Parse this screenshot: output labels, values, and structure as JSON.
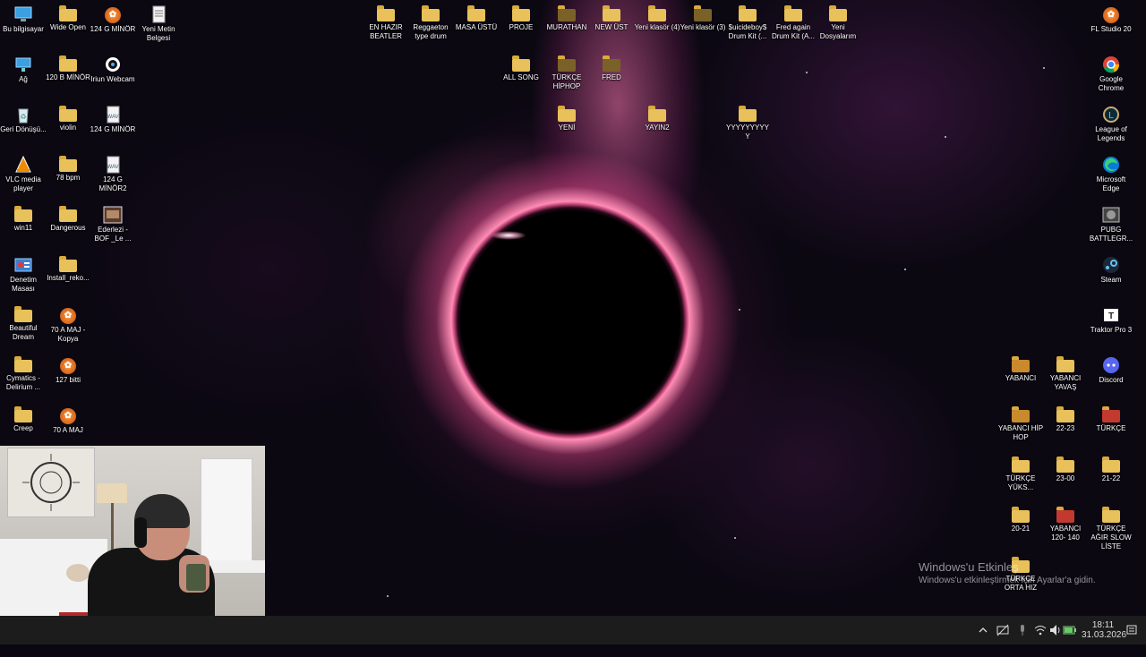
{
  "desktop": {
    "left_icons": [
      {
        "label": "Bu bilgisayar",
        "icon": "monitor-icon"
      },
      {
        "label": "Wide Open",
        "icon": "folder-icon"
      },
      {
        "label": "124 G MİNÖR",
        "icon": "fl-studio-project-icon"
      },
      {
        "label": "Yeni Metin Belgesi",
        "icon": "text-document-icon"
      },
      {
        "label": "Ağ",
        "icon": "network-icon"
      },
      {
        "label": "120 B MİNÖR",
        "icon": "folder-icon"
      },
      {
        "label": "Iriun Webcam",
        "icon": "webcam-icon"
      },
      {
        "label": "Geri Dönüşü...",
        "icon": "recycle-bin-icon"
      },
      {
        "label": "violin",
        "icon": "folder-icon"
      },
      {
        "label": "124 G MİNÖR",
        "icon": "audio-file-icon"
      },
      {
        "label": "VLC media player",
        "icon": "vlc-icon"
      },
      {
        "label": "78 bpm",
        "icon": "folder-icon"
      },
      {
        "label": "124 G MİNÖR2",
        "icon": "audio-file-icon"
      },
      {
        "label": "win11",
        "icon": "folder-icon"
      },
      {
        "label": "Dangerous",
        "icon": "folder-icon"
      },
      {
        "label": "Ederlezi - BOF _Le ...",
        "icon": "image-file-icon"
      },
      {
        "label": "Denetim Masası",
        "icon": "control-panel-icon"
      },
      {
        "label": "Install_reko...",
        "icon": "folder-icon"
      },
      {
        "label": "Beautiful Dream",
        "icon": "folder-icon"
      },
      {
        "label": "70 A MAJ - Kopya",
        "icon": "fl-studio-project-icon"
      },
      {
        "label": "Cymatics - Delirium ...",
        "icon": "folder-icon"
      },
      {
        "label": "127 bitti",
        "icon": "fl-studio-project-icon"
      },
      {
        "label": "Creep",
        "icon": "folder-icon"
      },
      {
        "label": "70 A MAJ",
        "icon": "fl-studio-project-icon"
      }
    ],
    "top_icons": [
      {
        "label": "EN HAZIR BEATLER",
        "icon": "folder-icon"
      },
      {
        "label": "Reggaeton type drum",
        "icon": "folder-icon"
      },
      {
        "label": "MASA ÜSTÜ",
        "icon": "folder-icon"
      },
      {
        "label": "PROJE",
        "icon": "folder-icon"
      },
      {
        "label": "MURATHAN",
        "icon": "folder-icon"
      },
      {
        "label": "NEW ÜST",
        "icon": "folder-icon"
      },
      {
        "label": "Yeni klasör (4)",
        "icon": "folder-icon"
      },
      {
        "label": "Yeni klasör (3)",
        "icon": "folder-icon"
      },
      {
        "label": "$uicideboy$ Drum Kit (...",
        "icon": "folder-icon"
      },
      {
        "label": "Fred again Drum Kit (A...",
        "icon": "folder-icon"
      },
      {
        "label": "Yeni Dosyalarım",
        "icon": "folder-icon"
      },
      {
        "label": "ALL SONG",
        "icon": "folder-icon"
      },
      {
        "label": "TÜRKÇE HİPHOP",
        "icon": "folder-icon"
      },
      {
        "label": "FRED",
        "icon": "folder-icon"
      },
      {
        "label": "YENİ",
        "icon": "folder-icon"
      },
      {
        "label": "YAYIN2",
        "icon": "folder-icon"
      },
      {
        "label": "YYYYYYYYYY",
        "icon": "folder-icon"
      }
    ],
    "right_icons": [
      {
        "label": "FL Studio 20",
        "icon": "fl-studio-icon"
      },
      {
        "label": "Google Chrome",
        "icon": "chrome-icon"
      },
      {
        "label": "League of Legends",
        "icon": "league-icon"
      },
      {
        "label": "Microsoft Edge",
        "icon": "edge-icon"
      },
      {
        "label": "PUBG BATTLEGR...",
        "icon": "pubg-icon"
      },
      {
        "label": "Steam",
        "icon": "steam-icon"
      },
      {
        "label": "Traktor Pro 3",
        "icon": "traktor-icon"
      },
      {
        "label": "YABANCI",
        "icon": "folder-icon"
      },
      {
        "label": "YABANCI YAVAŞ",
        "icon": "folder-icon"
      },
      {
        "label": "Discord",
        "icon": "discord-icon"
      },
      {
        "label": "YABANCI HİP HOP",
        "icon": "folder-icon"
      },
      {
        "label": "22-23",
        "icon": "folder-icon"
      },
      {
        "label": "TÜRKÇE",
        "icon": "folder-icon"
      },
      {
        "label": "TÜRKÇE YÜKS...",
        "icon": "folder-icon"
      },
      {
        "label": "23-00",
        "icon": "folder-icon"
      },
      {
        "label": "21-22",
        "icon": "folder-icon"
      },
      {
        "label": "20-21",
        "icon": "folder-icon"
      },
      {
        "label": "YABANCI 120- 140",
        "icon": "folder-icon"
      },
      {
        "label": "TÜRKÇE AĞIR SLOW LİSTE",
        "icon": "folder-icon"
      },
      {
        "label": "TÜRKÇE ORTA HIZ",
        "icon": "folder-icon"
      }
    ]
  },
  "watermark": {
    "line1": "Windows'u Etkinleş",
    "line2": "Windows'u etkinleştirmek için Ayarlar'a gidin."
  },
  "taskbar": {
    "time": "18:11",
    "date": "31.03.2026",
    "tray_icons": [
      "chevron-up-icon",
      "network-off-icon",
      "microphone-icon",
      "wifi-icon",
      "volume-icon",
      "battery-icon"
    ],
    "notification_icon": "notification-icon"
  }
}
